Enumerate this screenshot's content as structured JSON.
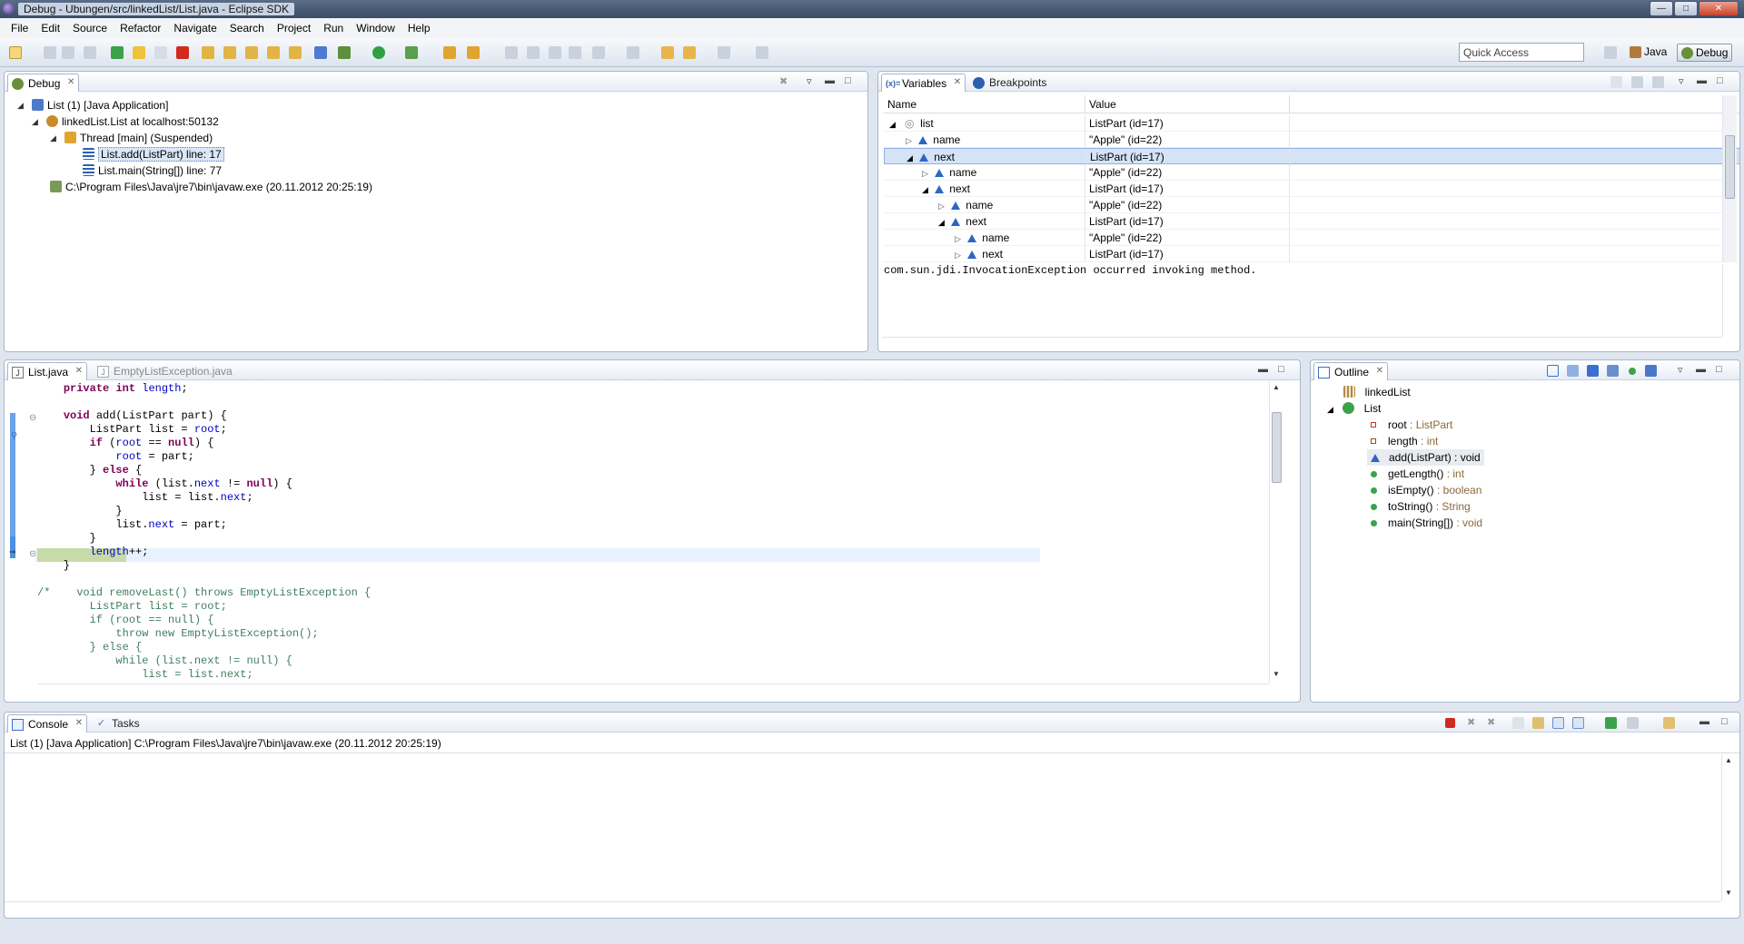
{
  "window": {
    "title": "Debug - Ubungen/src/linkedList/List.java - Eclipse SDK"
  },
  "menu": [
    "File",
    "Edit",
    "Source",
    "Refactor",
    "Navigate",
    "Search",
    "Project",
    "Run",
    "Window",
    "Help"
  ],
  "toolbar": {
    "quick_access_placeholder": "Quick Access",
    "perspectives": [
      "Java",
      "Debug"
    ],
    "active_perspective": "Debug"
  },
  "debug_view": {
    "tab": "Debug",
    "items": [
      {
        "label": "List (1) [Java Application]",
        "icon": "java-app-icon"
      },
      {
        "label": "linkedList.List at localhost:50132",
        "icon": "debug-target-icon"
      },
      {
        "label": "Thread [main] (Suspended)",
        "icon": "thread-suspended-icon"
      },
      {
        "label": "List.add(ListPart) line: 17",
        "icon": "stack-frame-icon",
        "selected": true
      },
      {
        "label": "List.main(String[]) line: 77",
        "icon": "stack-frame-icon"
      },
      {
        "label": "C:\\Program Files\\Java\\jre7\\bin\\javaw.exe (20.11.2012 20:25:19)",
        "icon": "process-icon"
      }
    ]
  },
  "variables_view": {
    "tabs": [
      "Variables",
      "Breakpoints"
    ],
    "columns": [
      "Name",
      "Value"
    ],
    "rows": [
      {
        "name": "list",
        "value": "ListPart  (id=17)"
      },
      {
        "name": "name",
        "value": "\"Apple\" (id=22)"
      },
      {
        "name": "next",
        "value": "ListPart  (id=17)"
      },
      {
        "name": "name",
        "value": "\"Apple\" (id=22)"
      },
      {
        "name": "next",
        "value": "ListPart  (id=17)"
      },
      {
        "name": "name",
        "value": "\"Apple\" (id=22)"
      },
      {
        "name": "next",
        "value": "ListPart  (id=17)"
      },
      {
        "name": "name",
        "value": "\"Apple\" (id=22)"
      },
      {
        "name": "next",
        "value": "ListPart  (id=17)"
      }
    ],
    "detail": "com.sun.jdi.InvocationException occurred invoking method."
  },
  "editor": {
    "tabs": [
      "List.java",
      "EmptyListException.java"
    ],
    "active_tab": "List.java"
  },
  "outline": {
    "tab": "Outline",
    "package": "linkedList",
    "class": "List",
    "members": [
      {
        "name": "root",
        "type": " : ListPart"
      },
      {
        "name": "length",
        "type": " : int"
      },
      {
        "name": "add(ListPart)",
        "type": " : void"
      },
      {
        "name": "getLength()",
        "type": " : int"
      },
      {
        "name": "isEmpty()",
        "type": " : boolean"
      },
      {
        "name": "toString()",
        "type": " : String"
      },
      {
        "name": "main(String[])",
        "type": " : void"
      }
    ]
  },
  "console": {
    "tabs": [
      "Console",
      "Tasks"
    ],
    "header": "List (1) [Java Application] C:\\Program Files\\Java\\jre7\\bin\\javaw.exe (20.11.2012 20:25:19)"
  }
}
